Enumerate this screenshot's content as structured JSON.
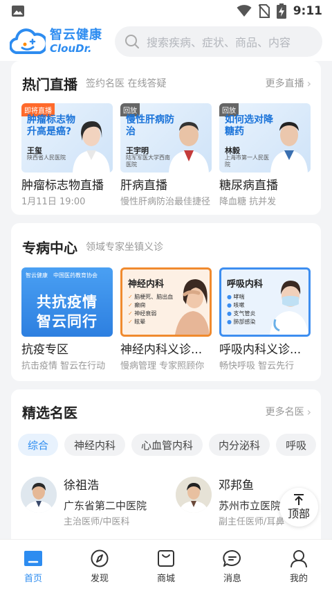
{
  "status_bar": {
    "time": "9:11"
  },
  "header": {
    "logo_cn": "智云健康",
    "logo_en": "ClouDr.",
    "search_placeholder": "搜索疾病、症状、商品、内容"
  },
  "live": {
    "title": "热门直播",
    "subtitle": "签约名医 在线答疑",
    "more": "更多直播",
    "items": [
      {
        "tag": "即将直播",
        "thumb_title": "肿瘤标志物升高是癌?",
        "doctor": "王玺",
        "hospital": "陕西省人民医院",
        "name": "肿瘤标志物直播",
        "desc": "1月11日 19:00",
        "tag_color": "#ff6a2b"
      },
      {
        "tag": "回放",
        "thumb_title": "慢性肝病防治",
        "doctor": "王宇明",
        "hospital": "陆军军医大学西南医院",
        "name": "肝病直播",
        "desc": "慢性肝病防治最佳捷径",
        "tag_color": "#666666"
      },
      {
        "tag": "回放",
        "thumb_title": "如何选对降糖药",
        "doctor": "林毅",
        "hospital": "上海市第一人民医院",
        "name": "糖尿病直播",
        "desc": "降血糖 抗并发",
        "tag_color": "#666666"
      }
    ]
  },
  "specialty": {
    "title": "专病中心",
    "subtitle": "领域专家坐镇义诊",
    "items": [
      {
        "thumb_line1": "共抗疫情",
        "thumb_line2": "智云同行",
        "banner_left": "智云健康",
        "banner_right": "中国医药教育协会",
        "name": "抗疫专区",
        "desc": "抗击疫情 智云在行动"
      },
      {
        "thumb_title": "神经内科",
        "bullets": [
          "脑梗死、脑出血",
          "癫痫",
          "神经衰弱",
          "眩晕"
        ],
        "name": "神经内科义诊...",
        "desc": "慢病管理 专家照顾你"
      },
      {
        "thumb_title": "呼吸内科",
        "bullets": [
          "哮喘",
          "咳嗽",
          "支气管炎",
          "肺部感染"
        ],
        "name": "呼吸内科义诊...",
        "desc": "畅快呼吸 智云先行"
      }
    ]
  },
  "doctors": {
    "title": "精选名医",
    "more": "更多名医",
    "tabs": [
      "综合",
      "神经内科",
      "心血管内科",
      "内分泌科",
      "呼吸"
    ],
    "items": [
      {
        "name": "徐祖浩",
        "hospital": "广东省第二中医院",
        "title": "主治医师/中医科"
      },
      {
        "name": "邓邦鱼",
        "hospital": "苏州市立医院",
        "title": "副主任医师/耳鼻"
      }
    ]
  },
  "to_top": "顶部",
  "bottom_nav": [
    {
      "label": "首页"
    },
    {
      "label": "发现"
    },
    {
      "label": "商城"
    },
    {
      "label": "消息"
    },
    {
      "label": "我的"
    }
  ],
  "colors": {
    "accent": "#2d8cf0"
  }
}
